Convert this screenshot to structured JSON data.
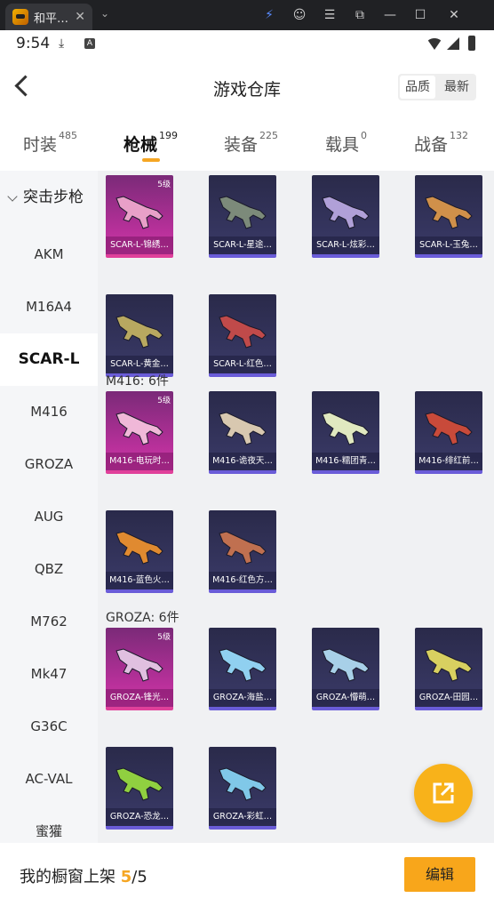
{
  "window": {
    "tab_title": "和平…",
    "tab_close": "✕",
    "tab_menu": "⌄",
    "controls": [
      "⚡",
      "☺",
      "☰",
      "⧉",
      "—",
      "☐",
      "✕"
    ]
  },
  "status_bar": {
    "time": "9:54",
    "download_icon": "⤓",
    "a_icon": "A"
  },
  "header": {
    "title": "游戏仓库",
    "sort_options": [
      "品质",
      "最新"
    ],
    "sort_selected": "品质"
  },
  "categories": [
    {
      "label": "时装",
      "count": "485"
    },
    {
      "label": "枪械",
      "count": "199"
    },
    {
      "label": "装备",
      "count": "225"
    },
    {
      "label": "载具",
      "count": "0"
    },
    {
      "label": "战备",
      "count": "132"
    }
  ],
  "sidebar": {
    "group": "突击步枪",
    "items": [
      "AKM",
      "M16A4",
      "SCAR-L",
      "M416",
      "GROZA",
      "AUG",
      "QBZ",
      "M762",
      "Mk47",
      "G36C",
      "AC-VAL",
      "蜜獾"
    ],
    "active": "SCAR-L"
  },
  "groups": [
    {
      "title": "",
      "cards": [
        {
          "name": "SCAR-L-锦绣…",
          "level": "5级",
          "quality": "pink",
          "color": "#e8a0c8"
        },
        {
          "name": "SCAR-L-星途…",
          "level": "",
          "quality": "purple",
          "color": "#7c8a7a"
        },
        {
          "name": "SCAR-L-炫彩…",
          "level": "",
          "quality": "purple",
          "color": "#b0a0d8"
        },
        {
          "name": "SCAR-L-玉兔…",
          "level": "",
          "quality": "purple",
          "color": "#d0904a"
        },
        {
          "name": "SCAR-L-黄金…",
          "level": "",
          "quality": "purple",
          "color": "#b8a860"
        },
        {
          "name": "SCAR-L-红色…",
          "level": "",
          "quality": "purple",
          "color": "#c04a4a"
        }
      ]
    },
    {
      "title": "M416: 6件",
      "cards": [
        {
          "name": "M416-电玩时…",
          "level": "5级",
          "quality": "pink",
          "color": "#f0b8d8"
        },
        {
          "name": "M416-诡夜天…",
          "level": "",
          "quality": "purple",
          "color": "#d8c8b0"
        },
        {
          "name": "M416-糯团青…",
          "level": "",
          "quality": "purple",
          "color": "#e0e8c0"
        },
        {
          "name": "M416-绯红前…",
          "level": "",
          "quality": "purple",
          "color": "#c84a3a"
        },
        {
          "name": "M416-蓝色火…",
          "level": "",
          "quality": "purple",
          "color": "#e08a30"
        },
        {
          "name": "M416-红色方…",
          "level": "",
          "quality": "purple",
          "color": "#c07050"
        }
      ]
    },
    {
      "title": "GROZA: 6件",
      "cards": [
        {
          "name": "GROZA-锋光…",
          "level": "5级",
          "quality": "pink",
          "color": "#e0c0e0"
        },
        {
          "name": "GROZA-海盐…",
          "level": "",
          "quality": "purple",
          "color": "#90d0f0"
        },
        {
          "name": "GROZA-懵萌…",
          "level": "",
          "quality": "purple",
          "color": "#a8d0e8"
        },
        {
          "name": "GROZA-田园…",
          "level": "",
          "quality": "purple",
          "color": "#d8d060"
        },
        {
          "name": "GROZA-恐龙…",
          "level": "",
          "quality": "purple",
          "color": "#90d040"
        },
        {
          "name": "GROZA-彩虹…",
          "level": "",
          "quality": "purple",
          "color": "#80c8e8"
        }
      ]
    }
  ],
  "footer": {
    "label": "我的橱窗上架",
    "current": "5",
    "total": "/5",
    "edit_label": "编辑"
  },
  "colors": {
    "accent": "#f5a623",
    "pink_card": "#cc3aa5",
    "purple_card": "#3a3a68"
  }
}
